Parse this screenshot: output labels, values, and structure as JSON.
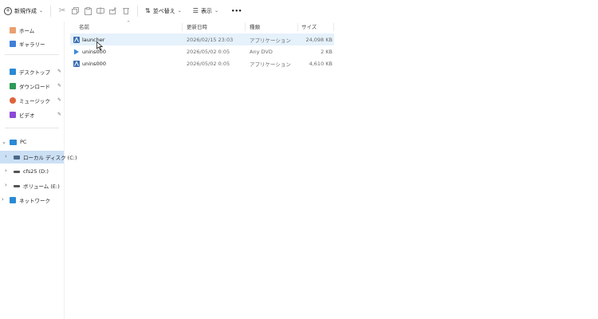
{
  "toolbar": {
    "new_label": "新規作成",
    "sort_label": "並べ替え",
    "view_label": "表示",
    "more_label": "•••"
  },
  "sidebar": {
    "quick": [
      {
        "label": "ホーム",
        "color": "#e07a3a"
      },
      {
        "label": "ギャラリー",
        "color": "#2f6fd6"
      }
    ],
    "pinned": [
      {
        "label": "デスクトップ",
        "color": "#2a8ad4"
      },
      {
        "label": "ダウンロード",
        "color": "#2e9a57"
      },
      {
        "label": "ミュージック",
        "color": "#e0643a"
      },
      {
        "label": "ビデオ",
        "color": "#8a4ad6"
      }
    ],
    "tree": [
      {
        "label": "PC",
        "color": "#2a8ad4"
      },
      {
        "label": "ローカル ディスク (C:)",
        "color": "#4a6a8a"
      },
      {
        "label": "cfs25 (D:)",
        "color": "#555555"
      },
      {
        "label": "ボリューム (E:)",
        "color": "#555555"
      },
      {
        "label": "ネットワーク",
        "color": "#2a8ad4"
      }
    ]
  },
  "columns": {
    "name": "名前",
    "modified": "更新日時",
    "type": "種類",
    "size": "サイズ"
  },
  "files": [
    {
      "name": "launcher",
      "modified": "2026/02/15 23:03",
      "type": "アプリケーション",
      "size": "24,098 KB",
      "icon": "app-icon"
    },
    {
      "name": "unins000",
      "modified": "2026/05/02 0:05",
      "type": "Any DVD",
      "size": "2 KB",
      "icon": "media-icon"
    },
    {
      "name": "unins000",
      "modified": "2026/05/02 0:05",
      "type": "アプリケーション",
      "size": "4,610 KB",
      "icon": "app-icon"
    }
  ]
}
